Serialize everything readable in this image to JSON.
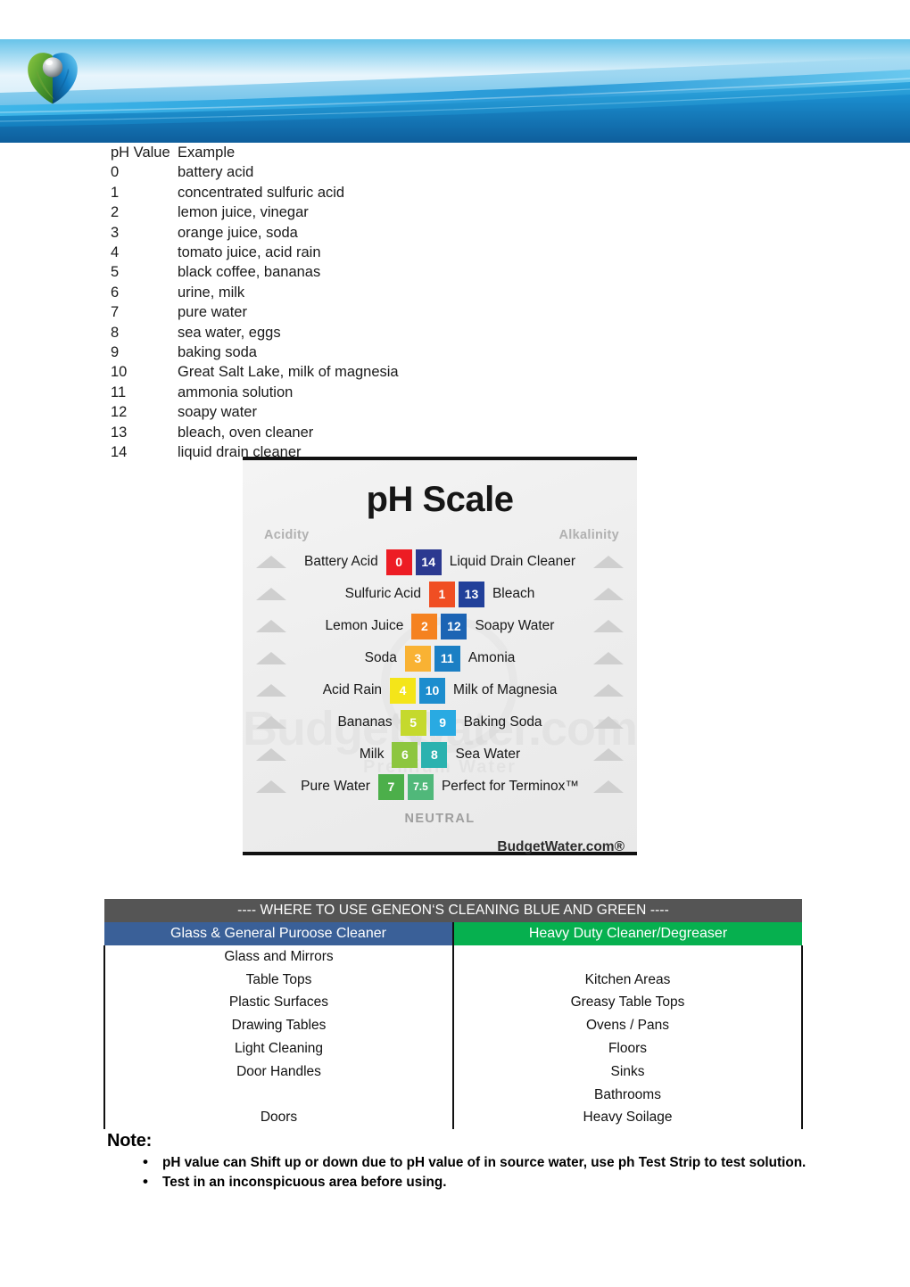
{
  "header": {
    "logo_name": "geneon-orb-logo",
    "banner_colors": {
      "deep_blue": "#0C7FC4",
      "mid_blue": "#3DB3E8",
      "pale_blue": "#CFEAF8",
      "dark_blue": "#0A5E9E"
    }
  },
  "ph_table": {
    "header_value": "pH Value",
    "header_example": "Example",
    "rows": [
      {
        "value": "0",
        "example": "battery acid"
      },
      {
        "value": "1",
        "example": "concentrated sulfuric acid"
      },
      {
        "value": "2",
        "example": "lemon juice, vinegar"
      },
      {
        "value": "3",
        "example": "orange juice, soda"
      },
      {
        "value": "4",
        "example": "tomato juice, acid rain"
      },
      {
        "value": "5",
        "example": "black coffee, bananas"
      },
      {
        "value": "6",
        "example": "urine, milk"
      },
      {
        "value": "7",
        "example": "pure water"
      },
      {
        "value": "8",
        "example": "sea water, eggs"
      },
      {
        "value": "9",
        "example": "baking soda"
      },
      {
        "value": "10",
        "example": "Great Salt Lake, milk of magnesia"
      },
      {
        "value": "11",
        "example": "ammonia solution"
      },
      {
        "value": "12",
        "example": "soapy water"
      },
      {
        "value": "13",
        "example": "bleach, oven cleaner"
      },
      {
        "value": "14",
        "example": "liquid drain cleaner"
      }
    ]
  },
  "ph_scale_graphic": {
    "title": "pH Scale",
    "left_axis_label": "Acidity",
    "right_axis_label": "Alkalinity",
    "neutral_label": "NEUTRAL",
    "credit": "BudgetWater.com®",
    "watermark_text": "BudgetWater.com",
    "watermark_subtext": "Premium Water",
    "rows": [
      {
        "left_label": "Battery Acid",
        "left_value": "0",
        "left_color": "#ED1C24",
        "right_value": "14",
        "right_color": "#2B3990",
        "right_label": "Liquid Drain Cleaner"
      },
      {
        "left_label": "Sulfuric Acid",
        "left_value": "1",
        "left_color": "#F04E23",
        "right_value": "13",
        "right_color": "#21409A",
        "right_label": "Bleach"
      },
      {
        "left_label": "Lemon Juice",
        "left_value": "2",
        "left_color": "#F58220",
        "right_value": "12",
        "right_color": "#1C64B4",
        "right_label": "Soapy Water"
      },
      {
        "left_label": "Soda",
        "left_value": "3",
        "left_color": "#F9B233",
        "right_value": "11",
        "right_color": "#1B7FC4",
        "right_label": "Amonia"
      },
      {
        "left_label": "Acid Rain",
        "left_value": "4",
        "left_color": "#F4E519",
        "right_value": "10",
        "right_color": "#1C8DCE",
        "right_label": "Milk of Magnesia"
      },
      {
        "left_label": "Bananas",
        "left_value": "5",
        "left_color": "#C5D92D",
        "right_value": "9",
        "right_color": "#29AAE2",
        "right_label": "Baking Soda"
      },
      {
        "left_label": "Milk",
        "left_value": "6",
        "left_color": "#8DC63F",
        "right_value": "8",
        "right_color": "#2BB2AF",
        "right_label": "Sea Water"
      },
      {
        "left_label": "Pure Water",
        "left_value": "7",
        "left_color": "#4CAF4A",
        "right_value": "7.5",
        "right_color": "#50B87A",
        "right_label": "Perfect for Terminox™"
      }
    ]
  },
  "use_table": {
    "title": "---- WHERE TO USE GENEON‘S CLEANING BLUE AND GREEN ----",
    "col_blue_header": "Glass & General Puroose Cleaner",
    "col_green_header": "Heavy Duty Cleaner/Degreaser",
    "blue_color": "#3A6098",
    "green_color": "#06B04F",
    "title_color": "#555555",
    "rows": [
      {
        "blue": "Glass and Mirrors",
        "green": ""
      },
      {
        "blue": "Table Tops",
        "green": "Kitchen Areas"
      },
      {
        "blue": "Plastic Surfaces",
        "green": "Greasy Table Tops"
      },
      {
        "blue": "Drawing Tables",
        "green": "Ovens / Pans"
      },
      {
        "blue": "Light Cleaning",
        "green": "Floors"
      },
      {
        "blue": "Door Handles",
        "green": "Sinks"
      },
      {
        "blue": "",
        "green": "Bathrooms"
      },
      {
        "blue": "Doors",
        "green": "Heavy Soilage"
      }
    ]
  },
  "note": {
    "heading": "Note:",
    "bullet_glyph": "•",
    "items": [
      "pH value can Shift up or down due to pH value of in source water, use ph Test Strip to test solution.",
      "Test in an inconspicuous area before using."
    ]
  }
}
